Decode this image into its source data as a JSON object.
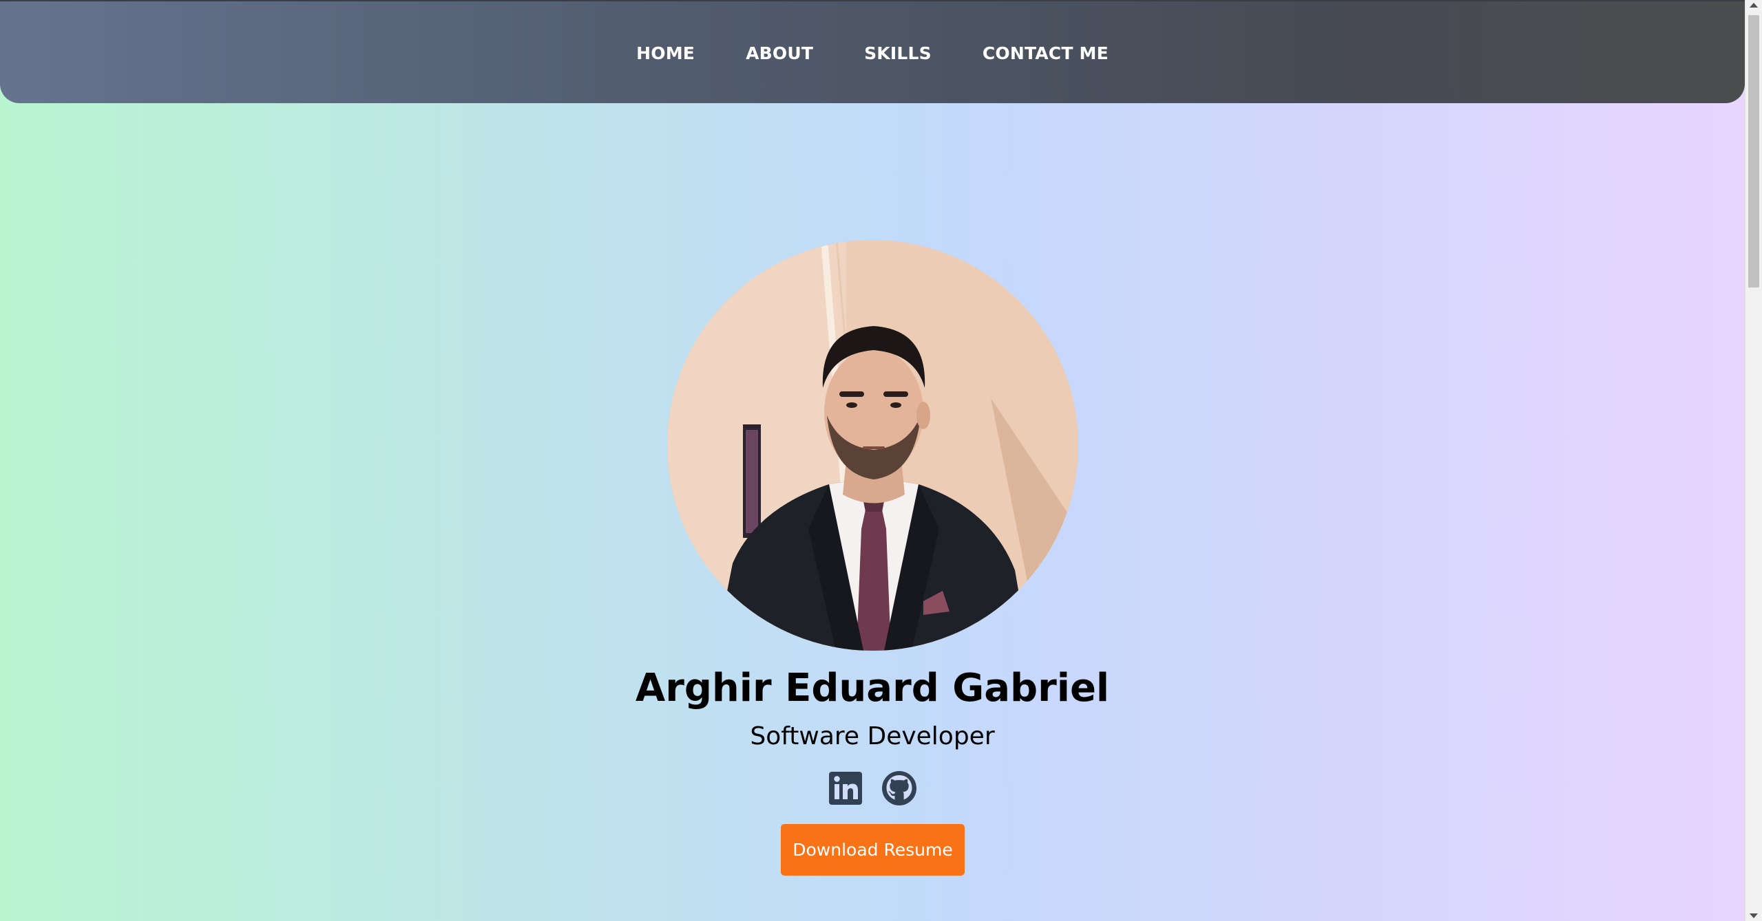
{
  "nav": {
    "items": [
      {
        "label": "HOME"
      },
      {
        "label": "ABOUT"
      },
      {
        "label": "SKILLS"
      },
      {
        "label": "CONTACT ME"
      }
    ]
  },
  "profile": {
    "name": "Arghir Eduard Gabriel",
    "role": "Software Developer",
    "photo_icon": "profile-photo"
  },
  "socials": [
    {
      "icon": "linkedin-icon"
    },
    {
      "icon": "github-icon"
    }
  ],
  "actions": {
    "download_label": "Download Resume"
  },
  "colors": {
    "accent": "#f97316",
    "nav_text": "#ffffff",
    "icon": "#334155"
  }
}
